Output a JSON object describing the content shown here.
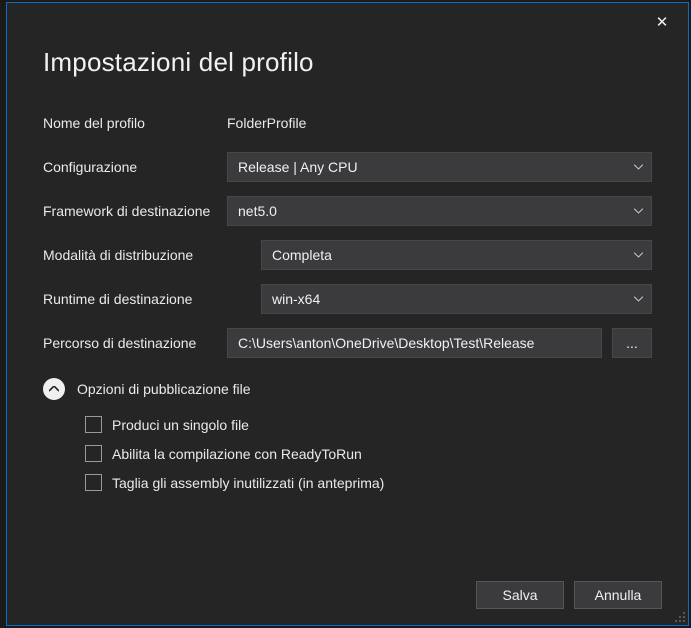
{
  "title": "Impostazioni del profilo",
  "close_glyph": "✕",
  "fields": {
    "profile_name": {
      "label": "Nome del profilo",
      "value": "FolderProfile"
    },
    "configuration": {
      "label": "Configurazione",
      "value": "Release | Any CPU"
    },
    "target_framework": {
      "label": "Framework di destinazione",
      "value": "net5.0"
    },
    "deployment_mode": {
      "label": "Modalità di distribuzione",
      "value": "Completa"
    },
    "target_runtime": {
      "label": "Runtime di destinazione",
      "value": "win-x64"
    },
    "target_path": {
      "label": "Percorso di destinazione",
      "value": "C:\\Users\\anton\\OneDrive\\Desktop\\Test\\Release",
      "browse": "..."
    }
  },
  "publish_options": {
    "header": "Opzioni di pubblicazione file",
    "items": [
      {
        "label": "Produci un singolo file",
        "checked": false
      },
      {
        "label": "Abilita la compilazione con ReadyToRun",
        "checked": false
      },
      {
        "label": "Taglia gli assembly inutilizzati (in anteprima)",
        "checked": false
      }
    ]
  },
  "footer": {
    "save": "Salva",
    "cancel": "Annulla"
  }
}
